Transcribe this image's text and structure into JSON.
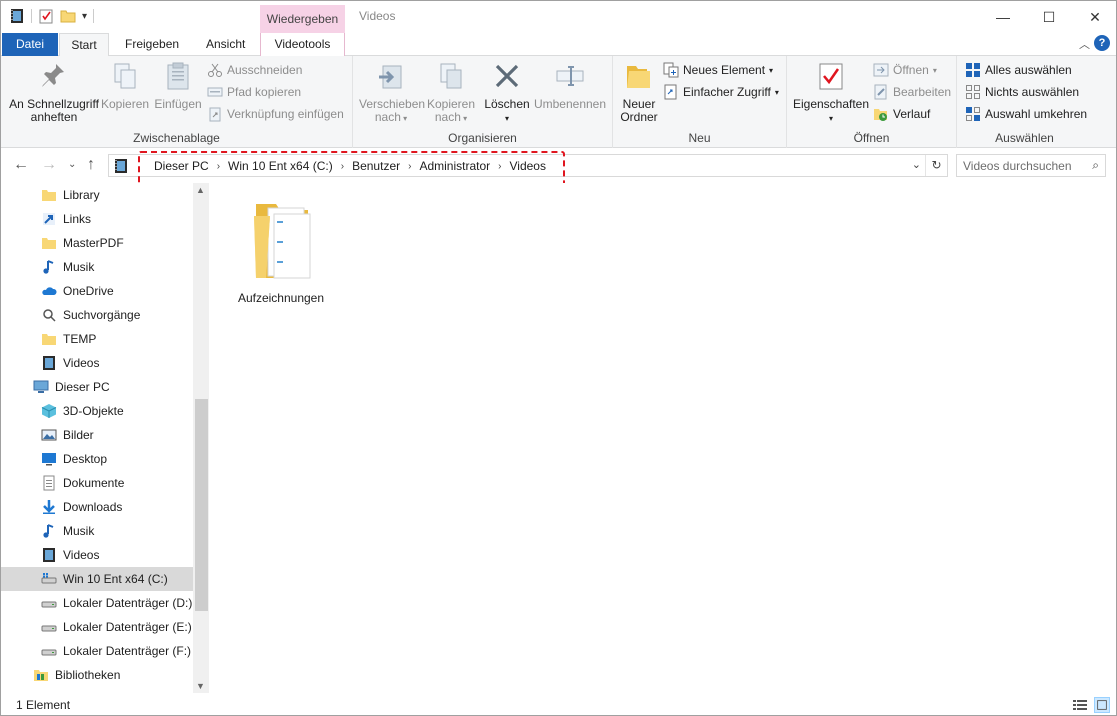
{
  "title_bar": {
    "context_tab": "Wiedergeben",
    "window_title": "Videos",
    "minimize": "—",
    "maximize": "☐",
    "close": "✕"
  },
  "tabs": {
    "file": "Datei",
    "start": "Start",
    "share": "Freigeben",
    "view": "Ansicht",
    "videotools": "Videotools"
  },
  "ribbon": {
    "clipboard": {
      "label": "Zwischenablage",
      "pin": "An Schnellzugriff anheften",
      "copy": "Kopieren",
      "paste": "Einfügen",
      "cut": "Ausschneiden",
      "copy_path": "Pfad kopieren",
      "paste_shortcut": "Verknüpfung einfügen"
    },
    "organize": {
      "label": "Organisieren",
      "move_to": "Verschieben nach",
      "copy_to": "Kopieren nach",
      "delete": "Löschen",
      "rename": "Umbenennen"
    },
    "new": {
      "label": "Neu",
      "new_folder": "Neuer Ordner",
      "new_item": "Neues Element",
      "easy_access": "Einfacher Zugriff"
    },
    "open": {
      "label": "Öffnen",
      "properties": "Eigenschaften",
      "open": "Öffnen",
      "edit": "Bearbeiten",
      "history": "Verlauf"
    },
    "select": {
      "label": "Auswählen",
      "select_all": "Alles auswählen",
      "select_none": "Nichts auswählen",
      "invert": "Auswahl umkehren"
    }
  },
  "address": {
    "crumbs": [
      "Dieser PC",
      "Win 10 Ent x64 (C:)",
      "Benutzer",
      "Administrator",
      "Videos"
    ],
    "search_placeholder": "Videos durchsuchen"
  },
  "nav_items": [
    {
      "label": "Library",
      "icon": "folder-icon"
    },
    {
      "label": "Links",
      "icon": "links-icon"
    },
    {
      "label": "MasterPDF",
      "icon": "folder-icon"
    },
    {
      "label": "Musik",
      "icon": "music-icon"
    },
    {
      "label": "OneDrive",
      "icon": "cloud-icon"
    },
    {
      "label": "Suchvorgänge",
      "icon": "search-icon"
    },
    {
      "label": "TEMP",
      "icon": "folder-icon"
    },
    {
      "label": "Videos",
      "icon": "video-icon"
    },
    {
      "label": "Dieser PC",
      "icon": "computer-icon"
    },
    {
      "label": "3D-Objekte",
      "icon": "cube-icon"
    },
    {
      "label": "Bilder",
      "icon": "pictures-icon"
    },
    {
      "label": "Desktop",
      "icon": "desktop-icon"
    },
    {
      "label": "Dokumente",
      "icon": "document-icon"
    },
    {
      "label": "Downloads",
      "icon": "download-icon"
    },
    {
      "label": "Musik",
      "icon": "music-icon"
    },
    {
      "label": "Videos",
      "icon": "video-icon"
    },
    {
      "label": "Win 10 Ent x64 (C:)",
      "icon": "drive-icon"
    },
    {
      "label": "Lokaler Datenträger (D:)",
      "icon": "drive-icon"
    },
    {
      "label": "Lokaler Datenträger (E:)",
      "icon": "drive-icon"
    },
    {
      "label": "Lokaler Datenträger (F:)",
      "icon": "drive-icon"
    },
    {
      "label": "Bibliotheken",
      "icon": "libraries-icon"
    }
  ],
  "content": {
    "folder_name": "Aufzeichnungen"
  },
  "status": {
    "count": "1 Element"
  },
  "colors": {
    "accent": "#1e64b8",
    "context_tab": "#f6d2e6",
    "highlight": "#e0151f",
    "folder": "#f8d775"
  }
}
